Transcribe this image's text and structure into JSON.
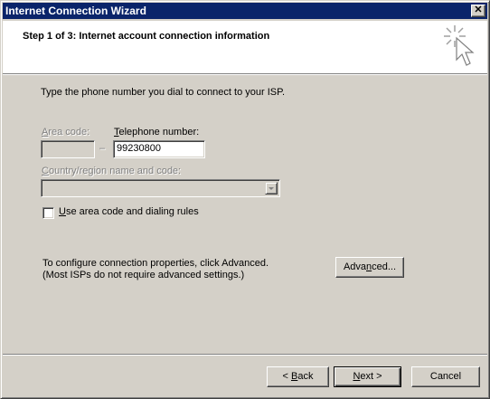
{
  "window": {
    "title": "Internet Connection Wizard",
    "close_glyph": "✕"
  },
  "header": {
    "step_title": "Step 1 of 3: Internet account connection information",
    "icon": "wizard-sparkle-cursor-icon"
  },
  "body": {
    "instruction": "Type the phone number you dial to connect to your ISP.",
    "area_code": {
      "label_hotkey": "A",
      "label_rest": "rea code:",
      "value": "",
      "enabled": false
    },
    "dash": "–",
    "telephone": {
      "label_hotkey": "T",
      "label_rest": "elephone number:",
      "value": "99230800",
      "enabled": true
    },
    "country": {
      "label_hotkey": "C",
      "label_rest": "ountry/region name and code:",
      "selected": "",
      "enabled": false
    },
    "use_area_code": {
      "label_hotkey": "U",
      "label_rest": "se area code and dialing rules",
      "checked": false
    },
    "advanced_info_line1": "To configure connection properties, click Advanced.",
    "advanced_info_line2": "(Most ISPs do not require advanced settings.)",
    "advanced_button": {
      "pre": "Adva",
      "hotkey": "n",
      "post": "ced..."
    }
  },
  "footer": {
    "back": {
      "pre": "< ",
      "hotkey": "B",
      "post": "ack",
      "enabled": true
    },
    "next": {
      "hotkey": "N",
      "post": "ext >",
      "default": true
    },
    "cancel": {
      "label": "Cancel"
    }
  },
  "colors": {
    "face": "#d4d0c8",
    "titlebar": "#0a246a",
    "header_bg": "#ffffff",
    "disabled_text": "#808080"
  }
}
